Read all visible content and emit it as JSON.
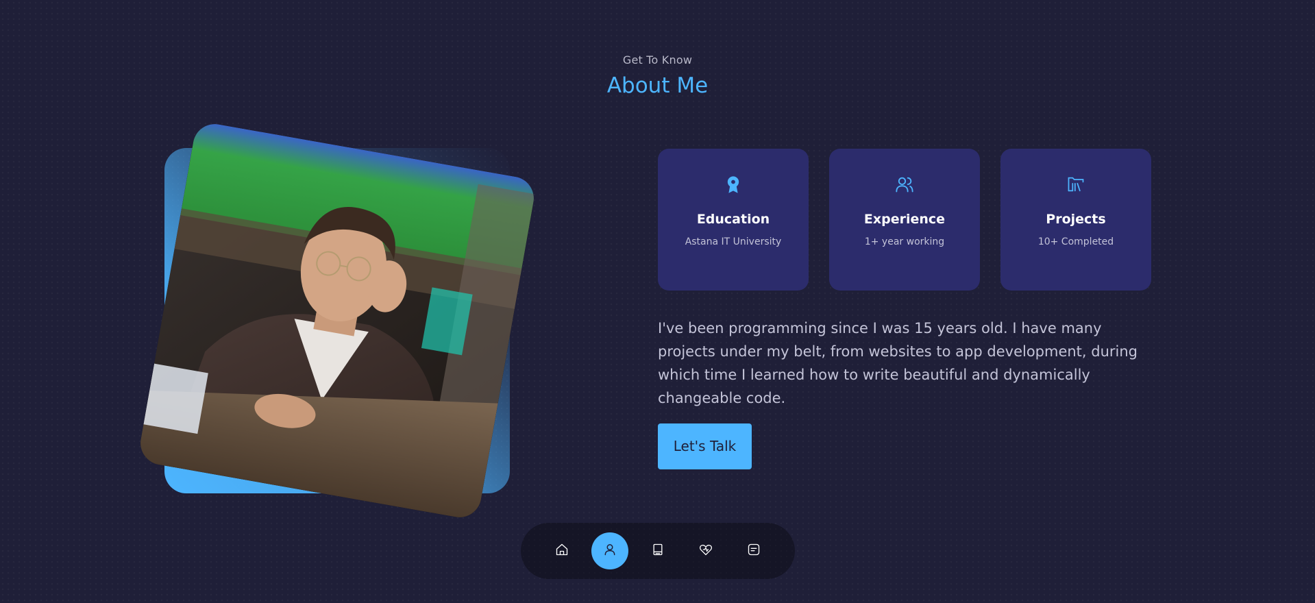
{
  "header": {
    "subtitle": "Get To Know",
    "title": "About Me"
  },
  "photo": {
    "alt": "Portrait photo"
  },
  "cards": [
    {
      "icon": "award-icon",
      "title": "Education",
      "subtitle": "Astana IT University"
    },
    {
      "icon": "users-icon",
      "title": "Experience",
      "subtitle": "1+ year working"
    },
    {
      "icon": "folder-library-icon",
      "title": "Projects",
      "subtitle": "10+ Completed"
    }
  ],
  "about_text": "I've been programming since I was 15 years old. I have many projects under my belt, from websites to app development, during which time I learned how to write beautiful and dynamically changeable code.",
  "cta_label": "Let's Talk",
  "nav": {
    "items": [
      {
        "icon": "home-icon",
        "active": false
      },
      {
        "icon": "user-icon",
        "active": true
      },
      {
        "icon": "book-icon",
        "active": false
      },
      {
        "icon": "heart-pulse-icon",
        "active": false
      },
      {
        "icon": "message-icon",
        "active": false
      }
    ]
  },
  "colors": {
    "background": "#1f1f38",
    "accent": "#4db5ff",
    "card": "#2c2c6c",
    "text_light": "#c4c4d8"
  }
}
